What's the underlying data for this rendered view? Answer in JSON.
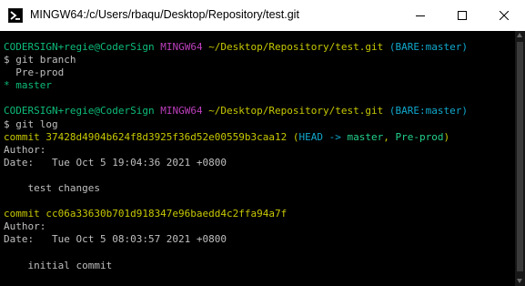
{
  "window": {
    "title": "MINGW64:/c/Users/rbaqu/Desktop/Repository/test.git",
    "icon": "mingw-terminal-icon",
    "controls": [
      "minimize-icon",
      "maximize-icon",
      "close-icon"
    ]
  },
  "colors": {
    "background": "#000000",
    "text": "#bfbfbf",
    "green": "#0dbc79",
    "magenta": "#bc3fbc",
    "yellow": "#c7c800",
    "cyan": "#11a8cd",
    "bright_green": "#23d18b"
  },
  "terminal": {
    "lines": [
      [
        {
          "text": "CODERSIGN+regie@CoderSign",
          "color": "green"
        },
        {
          "text": " "
        },
        {
          "text": "MINGW64",
          "color": "magenta"
        },
        {
          "text": " "
        },
        {
          "text": "~/Desktop/Repository/test.git",
          "color": "yellow"
        },
        {
          "text": " "
        },
        {
          "text": "(BARE:master)",
          "color": "cyan"
        }
      ],
      [
        {
          "text": "$ git branch"
        }
      ],
      [
        {
          "text": "  Pre-prod"
        }
      ],
      [
        {
          "text": "* master",
          "color": "green"
        }
      ],
      [
        {
          "text": ""
        }
      ],
      [
        {
          "text": "CODERSIGN+regie@CoderSign",
          "color": "green"
        },
        {
          "text": " "
        },
        {
          "text": "MINGW64",
          "color": "magenta"
        },
        {
          "text": " "
        },
        {
          "text": "~/Desktop/Repository/test.git",
          "color": "yellow"
        },
        {
          "text": " "
        },
        {
          "text": "(BARE:master)",
          "color": "cyan"
        }
      ],
      [
        {
          "text": "$ git log"
        }
      ],
      [
        {
          "text": "commit 37428d4904b624f8d3925f36d52e00559b3caa12 (",
          "color": "yellow"
        },
        {
          "text": "HEAD -> ",
          "color": "cyan"
        },
        {
          "text": "master",
          "color": "bright_green"
        },
        {
          "text": ", ",
          "color": "yellow"
        },
        {
          "text": "Pre-prod",
          "color": "bright_green"
        },
        {
          "text": ")",
          "color": "yellow"
        }
      ],
      [
        {
          "text": "Author: "
        }
      ],
      [
        {
          "text": "Date:   Tue Oct 5 19:04:36 2021 +0800"
        }
      ],
      [
        {
          "text": ""
        }
      ],
      [
        {
          "text": "    test changes"
        }
      ],
      [
        {
          "text": ""
        }
      ],
      [
        {
          "text": "commit cc06a33630b701d918347e96baedd4c2ffa94a7f",
          "color": "yellow"
        }
      ],
      [
        {
          "text": "Author: "
        }
      ],
      [
        {
          "text": "Date:   Tue Oct 5 08:03:57 2021 +0800"
        }
      ],
      [
        {
          "text": ""
        }
      ],
      [
        {
          "text": "    initial commit"
        }
      ]
    ]
  }
}
